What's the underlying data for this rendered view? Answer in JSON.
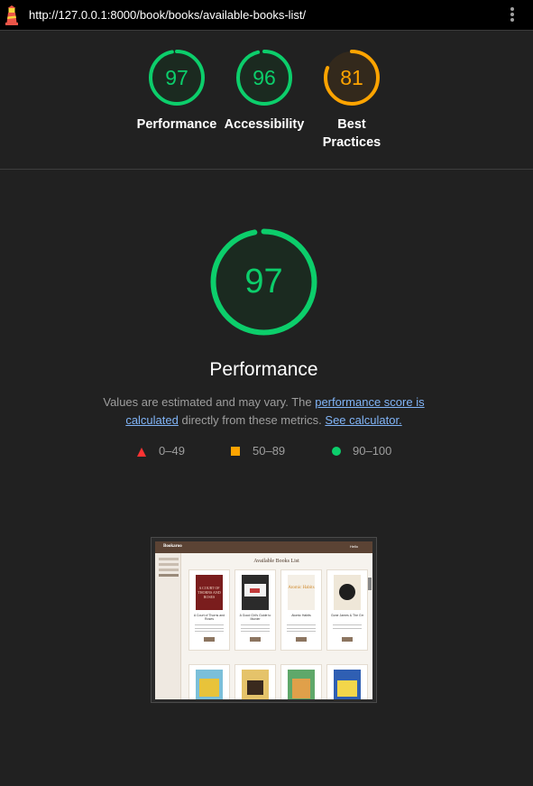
{
  "browser": {
    "url": "http://127.0.0.1:8000/book/books/available-books-list/",
    "logo_icon": "lighthouse-icon",
    "menu_icon": "kebab-menu-icon"
  },
  "summary_gauges": [
    {
      "label": "Performance",
      "score": "97",
      "color": "#0cce6b"
    },
    {
      "label": "Accessibility",
      "score": "96",
      "color": "#0cce6b"
    },
    {
      "label_line1": "Best",
      "label_line2": "Practices",
      "score": "81",
      "color": "#ffa400"
    }
  ],
  "main_gauge": {
    "score": "97",
    "title": "Performance",
    "color": "#0cce6b"
  },
  "description": {
    "text_before": "Values are estimated and may vary. The ",
    "link1": "performance score is calculated",
    "text_middle": " directly from these metrics. ",
    "link2": "See calculator."
  },
  "legend": [
    {
      "range": "0–49",
      "shape": "triangle",
      "color": "#ff3333"
    },
    {
      "range": "50–89",
      "shape": "square",
      "color": "#ffa400"
    },
    {
      "range": "90–100",
      "shape": "circle",
      "color": "#0cce6b"
    }
  ],
  "screenshot": {
    "brand": "Bookaroo",
    "user": "Hello",
    "page_title": "Available Books List",
    "books": [
      {
        "title": "A Court of Thorns and Roses",
        "cover_text": "A COURT OF THORNS AND ROSES"
      },
      {
        "title": "A Good Girl's Guide to Murder",
        "cover_text": ""
      },
      {
        "title": "Atomic Habits",
        "cover_text": "Atomic Habits"
      },
      {
        "title": "Gone James & The Grr",
        "cover_text": ""
      }
    ]
  }
}
